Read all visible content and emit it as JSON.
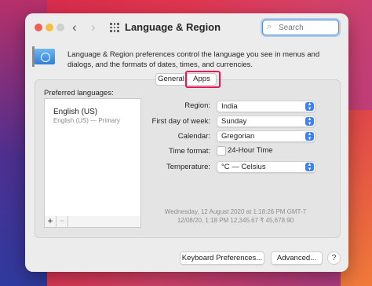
{
  "window": {
    "title": "Language & Region",
    "search_placeholder": "Search",
    "nav_back": "‹",
    "nav_forward": "›"
  },
  "description": "Language & Region preferences control the language you see in menus and dialogs, and the formats of dates, times, and currencies.",
  "tabs": [
    {
      "label": "General",
      "selected": false
    },
    {
      "label": "Apps",
      "selected": true
    }
  ],
  "preferred_languages": {
    "label": "Preferred languages:",
    "items": [
      {
        "name": "English (US)",
        "sub": "English (US) — Primary"
      }
    ],
    "add_label": "+",
    "remove_label": "−"
  },
  "settings": {
    "region": {
      "label": "Region:",
      "value": "India"
    },
    "first_day": {
      "label": "First day of week:",
      "value": "Sunday"
    },
    "calendar": {
      "label": "Calendar:",
      "value": "Gregorian"
    },
    "time_format": {
      "label": "Time format:",
      "checkbox_label": "24-Hour Time",
      "checked": false
    },
    "temperature": {
      "label": "Temperature:",
      "value": "°C — Celsius"
    }
  },
  "sample": {
    "line1": "Wednesday, 12 August 2020 at 1:18:26 PM GMT-7",
    "line2": "12/08/20, 1:18 PM     12,345.67     ₹ 45,678.90"
  },
  "buttons": {
    "keyboard": "Keyboard Preferences...",
    "advanced": "Advanced...",
    "help": "?"
  },
  "colors": {
    "highlight_border": "#e4185a",
    "popup_accent": "#3b82f6"
  }
}
